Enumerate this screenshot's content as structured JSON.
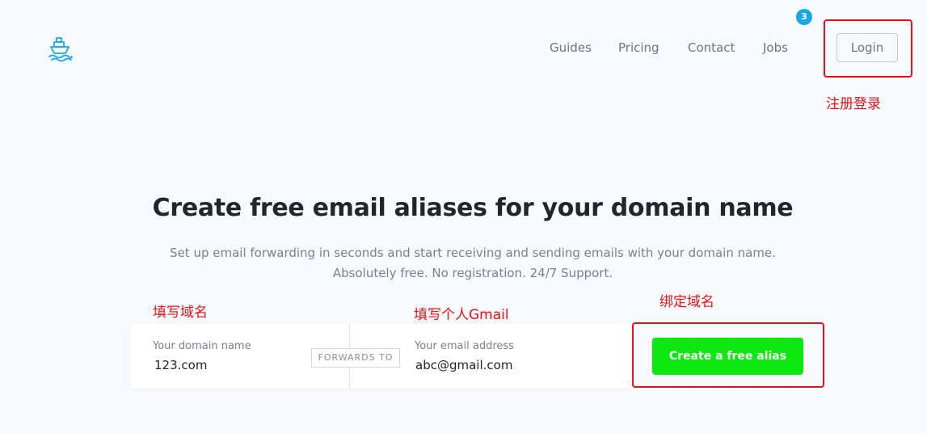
{
  "brand": {
    "logo_icon": "ship-icon",
    "accent_color": "#19a5e6"
  },
  "nav": {
    "items": [
      {
        "label": "Guides"
      },
      {
        "label": "Pricing"
      },
      {
        "label": "Contact"
      },
      {
        "label": "Jobs"
      }
    ],
    "jobs_badge": "3",
    "login_label": "Login"
  },
  "hero": {
    "title": "Create free email aliases for your domain name",
    "subtitle_line1": "Set up email forwarding in seconds and start receiving and sending emails with your domain name.",
    "subtitle_line2": "Absolutely free. No registration. 24/7 Support."
  },
  "form": {
    "domain_label": "Your domain name",
    "domain_value": "123.com",
    "forwards_label": "FORWARDS TO",
    "email_label": "Your email address",
    "email_value": "abc@gmail.com",
    "create_label": "Create a free alias",
    "button_color": "#0ce80f"
  },
  "annotations": {
    "login": "注册登录",
    "domain": "填写域名",
    "gmail": "填写个人Gmail",
    "bind": "绑定域名",
    "color": "#e3131b"
  }
}
